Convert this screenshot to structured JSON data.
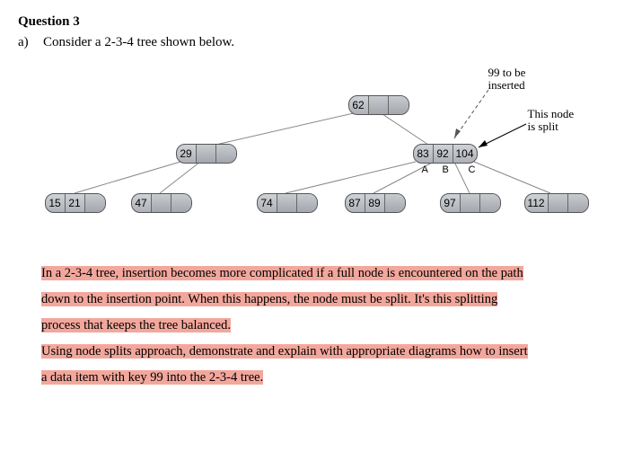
{
  "heading": "Question 3",
  "part_label": "a)",
  "prompt": "Consider a 2-3-4 tree shown below.",
  "annotations": {
    "inserted": "99 to be\ninserted",
    "split": "This node\nis split",
    "A": "A",
    "B": "B",
    "C": "C"
  },
  "tree": {
    "root": [
      "62",
      "",
      ""
    ],
    "n29": [
      "29",
      "",
      ""
    ],
    "n839": [
      "83",
      "92",
      "104"
    ],
    "n1521": [
      "15",
      "21",
      ""
    ],
    "n47": [
      "47",
      "",
      ""
    ],
    "n74": [
      "74",
      "",
      ""
    ],
    "n8789": [
      "87",
      "89",
      ""
    ],
    "n97": [
      "97",
      "",
      ""
    ],
    "n112": [
      "112",
      "",
      ""
    ]
  },
  "body_text": {
    "p1a": "In a 2-3-4 tree, insertion becomes more complicated if a full node is encountered on the path",
    "p1b": "down to the insertion point. When this happens, the node must be split. It's this splitting",
    "p1c": "process that keeps the tree balanced.",
    "p2a": "Using node splits approach, demonstrate and explain with appropriate diagrams how to insert",
    "p2b": "a data item with key 99 into the 2-3-4 tree."
  }
}
